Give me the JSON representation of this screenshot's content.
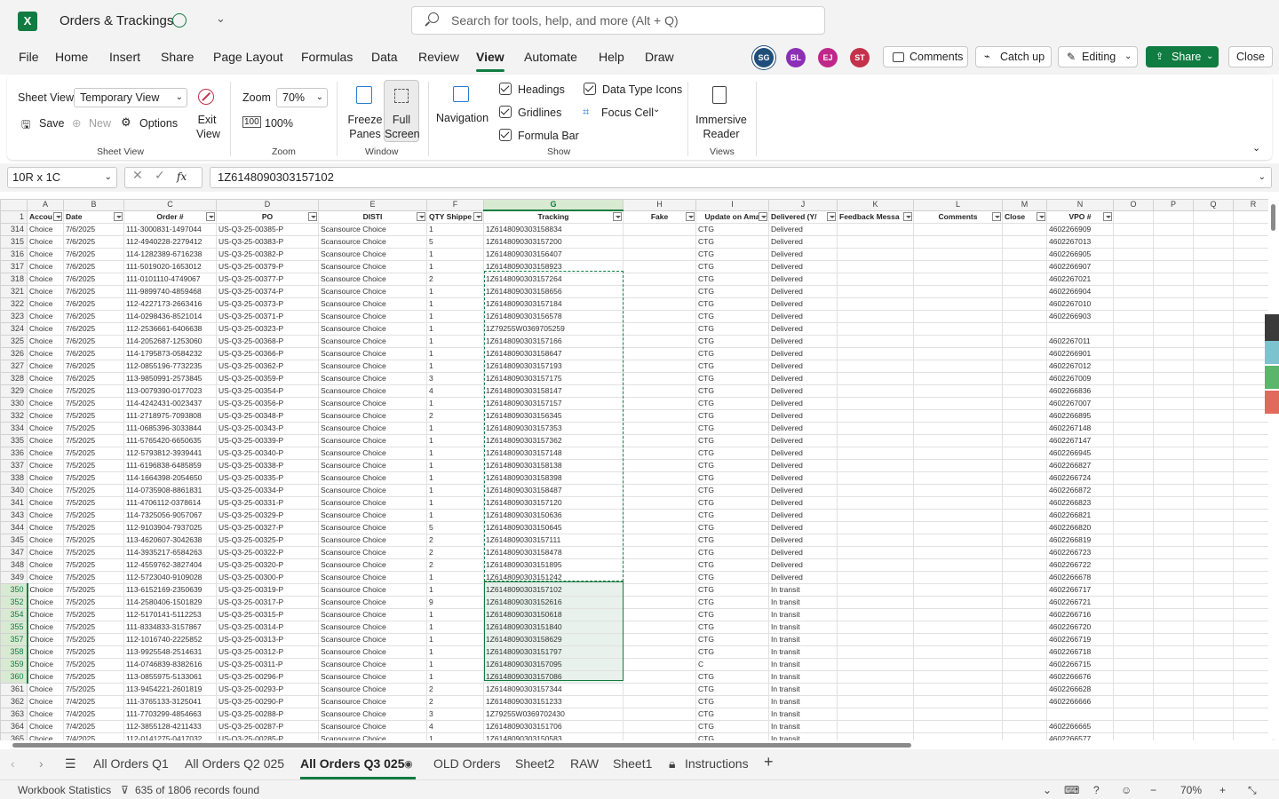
{
  "app": {
    "title": "Orders & Trackings",
    "logo": "X"
  },
  "search": {
    "placeholder": "Search for tools, help, and more (Alt + Q)"
  },
  "menu": [
    "File",
    "Home",
    "Insert",
    "Share",
    "Page Layout",
    "Formulas",
    "Data",
    "Review",
    "View",
    "Automate",
    "Help",
    "Draw"
  ],
  "active_menu": "View",
  "avatars": [
    {
      "initials": "SG",
      "color": "#1f4e79"
    },
    {
      "initials": "BL",
      "color": "#8b2fb5"
    },
    {
      "initials": "EJ",
      "color": "#c0278a"
    },
    {
      "initials": "ST",
      "color": "#c4314b"
    }
  ],
  "header_buttons": {
    "comments": "Comments",
    "catchup": "Catch up",
    "editing": "Editing",
    "share": "Share",
    "close": "Close"
  },
  "ribbon": {
    "sheet_view_label": "Sheet View",
    "sheet_view_value": "Temporary View",
    "save": "Save",
    "new": "New",
    "options": "Options",
    "exit_view": "Exit View",
    "group_sheet_view": "Sheet View",
    "zoom_label": "Zoom",
    "zoom_value": "70%",
    "zoom_100": "100%",
    "group_zoom": "Zoom",
    "freeze_panes": "Freeze Panes",
    "full_screen": "Full Screen",
    "group_window": "Window",
    "navigation": "Navigation",
    "headings": "Headings",
    "gridlines": "Gridlines",
    "formula_bar": "Formula Bar",
    "data_type_icons": "Data Type Icons",
    "focus_cell": "Focus Cell",
    "group_show": "Show",
    "immersive_reader": "Immersive Reader",
    "group_views": "Views"
  },
  "formula_bar": {
    "name_box": "10R x 1C",
    "fx": "fx",
    "value": "1Z6148090303157102"
  },
  "grid": {
    "columns": [
      "A",
      "B",
      "C",
      "D",
      "E",
      "F",
      "G",
      "H",
      "I",
      "J",
      "K",
      "L",
      "M",
      "N",
      "O",
      "P",
      "Q",
      "R"
    ],
    "selected_column": "G",
    "headers": [
      "Accou",
      "Date",
      "Order #",
      "PO",
      "DISTI",
      "QTY Shippe",
      "Tracking",
      "Fake",
      "Update on Ama",
      "Delivered (Y/",
      "Feedback Messa",
      "Comments",
      "Close",
      "VPO #",
      "",
      "",
      "",
      ""
    ],
    "rows": [
      [
        "314",
        "Choice",
        "7/6/2025",
        "111-3000831-1497044",
        "US-Q3-25-00385-P",
        "Scansource Choice",
        "1",
        "1Z6148090303158834",
        "",
        "CTG",
        "Delivered",
        "",
        "",
        "",
        "4602266909"
      ],
      [
        "315",
        "Choice",
        "7/6/2025",
        "112-4940228-2279412",
        "US-Q3-25-00383-P",
        "Scansource Choice",
        "5",
        "1Z6148090303157200",
        "",
        "CTG",
        "Delivered",
        "",
        "",
        "",
        "4602267013"
      ],
      [
        "316",
        "Choice",
        "7/6/2025",
        "114-1282389-6716238",
        "US-Q3-25-00382-P",
        "Scansource Choice",
        "1",
        "1Z6148090303156407",
        "",
        "CTG",
        "Delivered",
        "",
        "",
        "",
        "4602266905"
      ],
      [
        "317",
        "Choice",
        "7/6/2025",
        "111-5019020-1653012",
        "US-Q3-25-00379-P",
        "Scansource Choice",
        "1",
        "1Z6148090303158923",
        "",
        "CTG",
        "Delivered",
        "",
        "",
        "",
        "4602266907"
      ],
      [
        "318",
        "Choice",
        "7/6/2025",
        "111-0101110-4749067",
        "US-Q3-25-00377-P",
        "Scansource Choice",
        "2",
        "1Z6148090303157264",
        "",
        "CTG",
        "Delivered",
        "",
        "",
        "",
        "4602267021"
      ],
      [
        "321",
        "Choice",
        "7/6/2025",
        "111-9899740-4859468",
        "US-Q3-25-00374-P",
        "Scansource Choice",
        "1",
        "1Z6148090303158656",
        "",
        "CTG",
        "Delivered",
        "",
        "",
        "",
        "4602266904"
      ],
      [
        "322",
        "Choice",
        "7/6/2025",
        "112-4227173-2663416",
        "US-Q3-25-00373-P",
        "Scansource Choice",
        "1",
        "1Z6148090303157184",
        "",
        "CTG",
        "Delivered",
        "",
        "",
        "",
        "4602267010"
      ],
      [
        "323",
        "Choice",
        "7/6/2025",
        "114-0298436-8521014",
        "US-Q3-25-00371-P",
        "Scansource Choice",
        "1",
        "1Z6148090303156578",
        "",
        "CTG",
        "Delivered",
        "",
        "",
        "",
        "4602266903"
      ],
      [
        "324",
        "Choice",
        "7/6/2025",
        "112-2536661-6406638",
        "US-Q3-25-00323-P",
        "Scansource Choice",
        "1",
        "1Z79255W0369705259",
        "",
        "CTG",
        "Delivered",
        "",
        "",
        "",
        ""
      ],
      [
        "325",
        "Choice",
        "7/6/2025",
        "114-2052687-1253060",
        "US-Q3-25-00368-P",
        "Scansource Choice",
        "1",
        "1Z6148090303157166",
        "",
        "CTG",
        "Delivered",
        "",
        "",
        "",
        "4602267011"
      ],
      [
        "326",
        "Choice",
        "7/6/2025",
        "114-1795873-0584232",
        "US-Q3-25-00366-P",
        "Scansource Choice",
        "1",
        "1Z6148090303158647",
        "",
        "CTG",
        "Delivered",
        "",
        "",
        "",
        "4602266901"
      ],
      [
        "327",
        "Choice",
        "7/6/2025",
        "112-0855196-7732235",
        "US-Q3-25-00362-P",
        "Scansource Choice",
        "1",
        "1Z6148090303157193",
        "",
        "CTG",
        "Delivered",
        "",
        "",
        "",
        "4602267012"
      ],
      [
        "328",
        "Choice",
        "7/6/2025",
        "113-9850991-2573845",
        "US-Q3-25-00359-P",
        "Scansource Choice",
        "3",
        "1Z6148090303157175",
        "",
        "CTG",
        "Delivered",
        "",
        "",
        "",
        "4602267009"
      ],
      [
        "329",
        "Choice",
        "7/5/2025",
        "113-0079390-0177023",
        "US-Q3-25-00354-P",
        "Scansource Choice",
        "4",
        "1Z6148090303158147",
        "",
        "CTG",
        "Delivered",
        "",
        "",
        "",
        "4602266836"
      ],
      [
        "330",
        "Choice",
        "7/5/2025",
        "114-4242431-0023437",
        "US-Q3-25-00356-P",
        "Scansource Choice",
        "1",
        "1Z6148090303157157",
        "",
        "CTG",
        "Delivered",
        "",
        "",
        "",
        "4602267007"
      ],
      [
        "332",
        "Choice",
        "7/5/2025",
        "111-2718975-7093808",
        "US-Q3-25-00348-P",
        "Scansource Choice",
        "2",
        "1Z6148090303156345",
        "",
        "CTG",
        "Delivered",
        "",
        "",
        "",
        "4602266895"
      ],
      [
        "334",
        "Choice",
        "7/5/2025",
        "111-0685396-3033844",
        "US-Q3-25-00343-P",
        "Scansource Choice",
        "1",
        "1Z6148090303157353",
        "",
        "CTG",
        "Delivered",
        "",
        "",
        "",
        "4602267148"
      ],
      [
        "335",
        "Choice",
        "7/5/2025",
        "111-5765420-6650635",
        "US-Q3-25-00339-P",
        "Scansource Choice",
        "1",
        "1Z6148090303157362",
        "",
        "CTG",
        "Delivered",
        "",
        "",
        "",
        "4602267147"
      ],
      [
        "336",
        "Choice",
        "7/5/2025",
        "112-5793812-3939441",
        "US-Q3-25-00340-P",
        "Scansource Choice",
        "1",
        "1Z6148090303157148",
        "",
        "CTG",
        "Delivered",
        "",
        "",
        "",
        "4602266945"
      ],
      [
        "337",
        "Choice",
        "7/5/2025",
        "111-6196838-6485859",
        "US-Q3-25-00338-P",
        "Scansource Choice",
        "1",
        "1Z6148090303158138",
        "",
        "CTG",
        "Delivered",
        "",
        "",
        "",
        "4602266827"
      ],
      [
        "338",
        "Choice",
        "7/5/2025",
        "114-1664398-2054650",
        "US-Q3-25-00335-P",
        "Scansource Choice",
        "1",
        "1Z6148090303158398",
        "",
        "CTG",
        "Delivered",
        "",
        "",
        "",
        "4602266724"
      ],
      [
        "340",
        "Choice",
        "7/5/2025",
        "114-0735908-8861831",
        "US-Q3-25-00334-P",
        "Scansource Choice",
        "1",
        "1Z6148090303158487",
        "",
        "CTG",
        "Delivered",
        "",
        "",
        "",
        "4602266872"
      ],
      [
        "341",
        "Choice",
        "7/5/2025",
        "111-4706112-0378614",
        "US-Q3-25-00331-P",
        "Scansource Choice",
        "1",
        "1Z6148090303157120",
        "",
        "CTG",
        "Delivered",
        "",
        "",
        "",
        "4602266823"
      ],
      [
        "343",
        "Choice",
        "7/5/2025",
        "114-7325056-9057067",
        "US-Q3-25-00329-P",
        "Scansource Choice",
        "1",
        "1Z6148090303150636",
        "",
        "CTG",
        "Delivered",
        "",
        "",
        "",
        "4602266821"
      ],
      [
        "344",
        "Choice",
        "7/5/2025",
        "112-9103904-7937025",
        "US-Q3-25-00327-P",
        "Scansource Choice",
        "5",
        "1Z6148090303150645",
        "",
        "CTG",
        "Delivered",
        "",
        "",
        "",
        "4602266820"
      ],
      [
        "345",
        "Choice",
        "7/5/2025",
        "113-4620607-3042638",
        "US-Q3-25-00325-P",
        "Scansource Choice",
        "2",
        "1Z6148090303157111",
        "",
        "CTG",
        "Delivered",
        "",
        "",
        "",
        "4602266819"
      ],
      [
        "347",
        "Choice",
        "7/5/2025",
        "114-3935217-6584263",
        "US-Q3-25-00322-P",
        "Scansource Choice",
        "2",
        "1Z6148090303158478",
        "",
        "CTG",
        "Delivered",
        "",
        "",
        "",
        "4602266723"
      ],
      [
        "348",
        "Choice",
        "7/5/2025",
        "112-4559762-3827404",
        "US-Q3-25-00320-P",
        "Scansource Choice",
        "2",
        "1Z6148090303151895",
        "",
        "CTG",
        "Delivered",
        "",
        "",
        "",
        "4602266722"
      ],
      [
        "349",
        "Choice",
        "7/5/2025",
        "112-5723040-9109028",
        "US-Q3-25-00300-P",
        "Scansource Choice",
        "1",
        "1Z6148090303151242",
        "",
        "CTG",
        "Delivered",
        "",
        "",
        "",
        "4602266678"
      ],
      [
        "350",
        "Choice",
        "7/5/2025",
        "113-6152169-2350639",
        "US-Q3-25-00319-P",
        "Scansource Choice",
        "1",
        "1Z6148090303157102",
        "",
        "CTG",
        "In transit",
        "",
        "",
        "",
        "4602266717"
      ],
      [
        "352",
        "Choice",
        "7/5/2025",
        "114-2580406-1501829",
        "US-Q3-25-00317-P",
        "Scansource Choice",
        "9",
        "1Z6148090303152616",
        "",
        "CTG",
        "In transit",
        "",
        "",
        "",
        "4602266721"
      ],
      [
        "354",
        "Choice",
        "7/5/2025",
        "112-5170141-5112253",
        "US-Q3-25-00315-P",
        "Scansource Choice",
        "1",
        "1Z6148090303150618",
        "",
        "CTG",
        "In transit",
        "",
        "",
        "",
        "4602266716"
      ],
      [
        "355",
        "Choice",
        "7/5/2025",
        "111-8334833-3157867",
        "US-Q3-25-00314-P",
        "Scansource Choice",
        "1",
        "1Z6148090303151840",
        "",
        "CTG",
        "In transit",
        "",
        "",
        "",
        "4602266720"
      ],
      [
        "357",
        "Choice",
        "7/5/2025",
        "112-1016740-2225852",
        "US-Q3-25-00313-P",
        "Scansource Choice",
        "1",
        "1Z6148090303158629",
        "",
        "CTG",
        "In transit",
        "",
        "",
        "",
        "4602266719"
      ],
      [
        "358",
        "Choice",
        "7/5/2025",
        "113-9925548-2514631",
        "US-Q3-25-00312-P",
        "Scansource Choice",
        "1",
        "1Z6148090303151797",
        "",
        "CTG",
        "In transit",
        "",
        "",
        "",
        "4602266718"
      ],
      [
        "359",
        "Choice",
        "7/5/2025",
        "114-0746839-8382616",
        "US-Q3-25-00311-P",
        "Scansource Choice",
        "1",
        "1Z6148090303157095",
        "",
        "C",
        "In transit",
        "",
        "",
        "",
        "4602266715"
      ],
      [
        "360",
        "Choice",
        "7/5/2025",
        "113-0855975-5133061",
        "US-Q3-25-00296-P",
        "Scansource Choice",
        "1",
        "1Z6148090303157086",
        "",
        "CTG",
        "In transit",
        "",
        "",
        "",
        "4602266676"
      ],
      [
        "361",
        "Choice",
        "7/5/2025",
        "113-9454221-2601819",
        "US-Q3-25-00293-P",
        "Scansource Choice",
        "2",
        "1Z6148090303157344",
        "",
        "CTG",
        "In transit",
        "",
        "",
        "",
        "4602266628"
      ],
      [
        "362",
        "Choice",
        "7/4/2025",
        "111-3765133-3125041",
        "US-Q3-25-00290-P",
        "Scansource Choice",
        "2",
        "1Z6148090303151233",
        "",
        "CTG",
        "In transit",
        "",
        "",
        "",
        "4602266666"
      ],
      [
        "363",
        "Choice",
        "7/4/2025",
        "111-7703299-4854663",
        "US-Q3-25-00288-P",
        "Scansource Choice",
        "3",
        "1Z79255W0369702430",
        "",
        "CTG",
        "In transit",
        "",
        "",
        "",
        ""
      ],
      [
        "364",
        "Choice",
        "7/4/2025",
        "112-3855128-4211433",
        "US-Q3-25-00287-P",
        "Scansource Choice",
        "4",
        "1Z6148090303151706",
        "",
        "CTG",
        "In transit",
        "",
        "",
        "",
        "4602266665"
      ],
      [
        "365",
        "Choice",
        "7/4/2025",
        "112-0141275-0417032",
        "US-Q3-25-00285-P",
        "Scansource Choice",
        "1",
        "1Z6148090303150583",
        "",
        "CTG",
        "In transit",
        "",
        "",
        "",
        "4602266577"
      ]
    ]
  },
  "sheet_tabs": [
    "All Orders Q1",
    "All Orders Q2 025",
    "All Orders Q3 025",
    "OLD Orders",
    "Sheet2",
    "RAW",
    "Sheet1",
    "Instructions"
  ],
  "active_tab": "All Orders Q3 025",
  "status": {
    "workbook_stats": "Workbook Statistics",
    "records": "635 of 1806 records found",
    "zoom": "70%"
  },
  "colors": {
    "accent": "#107c41",
    "selection_fill": "#e8f1ec"
  }
}
